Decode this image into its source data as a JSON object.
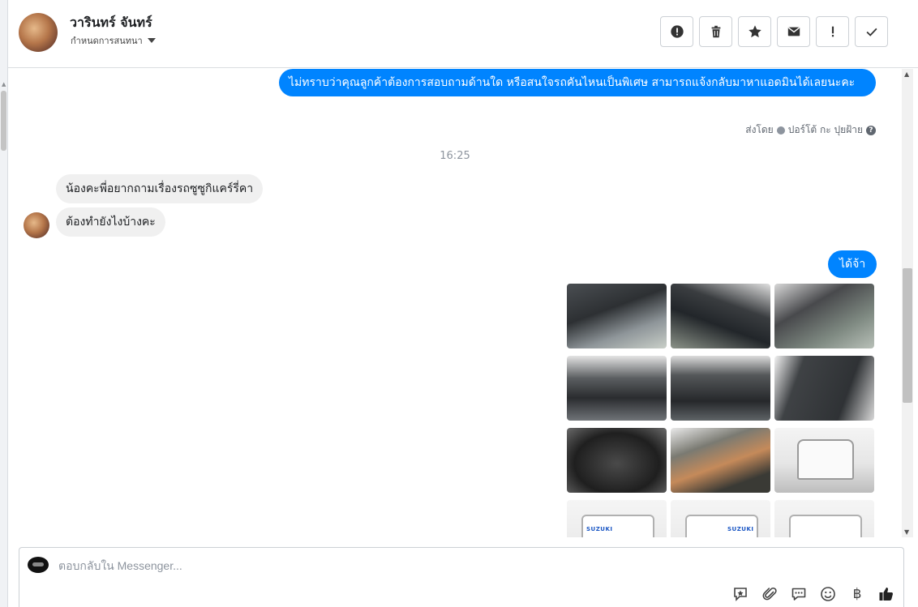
{
  "header": {
    "contact_name": "วารินทร์ จันทร์",
    "subtitle": "กำหนดการสนทนา",
    "actions": [
      {
        "name": "report-button",
        "icon": "alert-circle-icon"
      },
      {
        "name": "delete-button",
        "icon": "trash-icon"
      },
      {
        "name": "star-button",
        "icon": "star-icon"
      },
      {
        "name": "mark-unread-button",
        "icon": "envelope-icon"
      },
      {
        "name": "priority-button",
        "icon": "exclamation-icon"
      },
      {
        "name": "mark-done-button",
        "icon": "check-icon"
      }
    ]
  },
  "messages": {
    "outgoing_1": "ไม่ทราบว่าคุณลูกค้าต้องการสอบถามด้านใด หรือสนใจรถคันไหนเป็นพิเศษ สามารถแจ้งกลับมาหาแอดมินได้เลยนะคะ",
    "sent_by_prefix": "ส่งโดย",
    "sent_by_name": "ปอร์โต้ กะ ปุยฝ้าย",
    "timestamp": "16:25",
    "incoming_1": "น้องคะพี่อยากถามเรื่องรถซูซูกิแคร์รี่คา",
    "incoming_2": "ต้องทำยังไงบ้างคะ",
    "outgoing_2": "ได้จ้า",
    "photos": [
      "gear-shift-interior",
      "steering-wheel-interior",
      "seats-interior",
      "dashboard-vents",
      "dashboard-vents-2",
      "door-panel",
      "instrument-gauges",
      "engine-bay",
      "white-pickup-front",
      "suzuki-rear",
      "suzuki-rear-2",
      "white-pickup-rear"
    ],
    "brand_label": "SUZUKI"
  },
  "composer": {
    "placeholder": "ตอบกลับใน Messenger...",
    "tools": [
      "saved-replies-icon",
      "attachment-icon",
      "chat-bubble-icon",
      "emoji-icon",
      "baht-payment-icon",
      "thumbs-up-icon"
    ],
    "currency_symbol": "฿"
  },
  "colors": {
    "outgoing_bubble": "#0084ff",
    "incoming_bubble": "#f0f0f0"
  }
}
